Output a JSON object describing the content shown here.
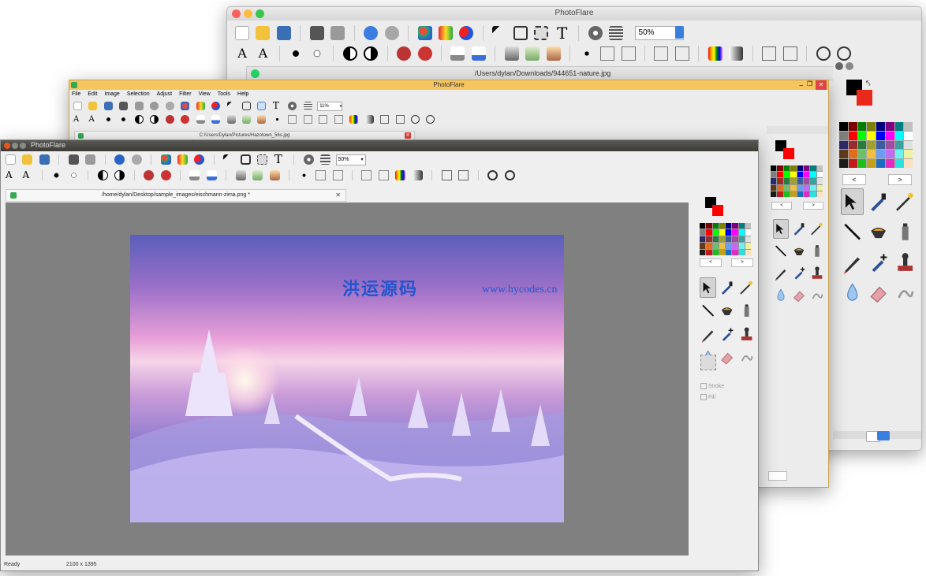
{
  "mac_window": {
    "title": "PhotoFlare",
    "zoom": "50%",
    "tab_path": "/Users/dylan/Downloads/944651-nature.jpg"
  },
  "win_window": {
    "title": "PhotoFlare",
    "menu": [
      "File",
      "Edit",
      "Image",
      "Selection",
      "Adjust",
      "Filter",
      "View",
      "Tools",
      "Help"
    ],
    "zoom": "11%",
    "tab_path": "C:/Users/Dylan/Pictures/Hazotown_56s.jpg",
    "close_glyph": "✕",
    "restore_glyph": "❐",
    "minimize_glyph": "_",
    "nav_prev": "<",
    "nav_next": ">"
  },
  "linux_window": {
    "title": "PhotoFlare",
    "zoom": "50%",
    "tab_path": "/home/dylan/Desktop/sample_images/eischmann-zima.png *",
    "tab_close": "✕",
    "nav_prev": "<",
    "nav_next": ">",
    "stroke_label": "Stroke",
    "fill_label": "Fill",
    "status_text": "Ready",
    "status_size": "2100 x 1395"
  },
  "mac_panel": {
    "nav_prev": "<",
    "nav_next": ">"
  },
  "watermark": {
    "chinese": "洪运源码",
    "url": "www.hycodes.cn"
  },
  "palette_colors": [
    "#000000",
    "#7f0000",
    "#007f00",
    "#7f7f00",
    "#00007f",
    "#7f007f",
    "#007f7f",
    "#c0c0c0",
    "#808080",
    "#ff0000",
    "#00ff00",
    "#ffff00",
    "#0000ff",
    "#ff00ff",
    "#00ffff",
    "#ffffff",
    "#2b2b6b",
    "#9b2c2c",
    "#2c7b3c",
    "#a0a030",
    "#3c5ca0",
    "#a04ca0",
    "#3ca0a0",
    "#e0e0e0",
    "#5c3c1c",
    "#e06c1c",
    "#6cc06c",
    "#f0c040",
    "#6c9cf0",
    "#c06cf0",
    "#6cf0f0",
    "#f0f0a0",
    "#1c1c1c",
    "#c01c1c",
    "#1cc01c",
    "#c0a01c",
    "#1c6cc0",
    "#e02cc0",
    "#2ce0e0",
    "#ffe0c0"
  ],
  "colors": {
    "accent_blue": "#3a7fe0",
    "win_title_bar": "#f6c560",
    "canvas_gray": "#808080",
    "fg_color": "#000000",
    "bg_color": "#ff0000",
    "watermark_color": "#2255cc"
  }
}
